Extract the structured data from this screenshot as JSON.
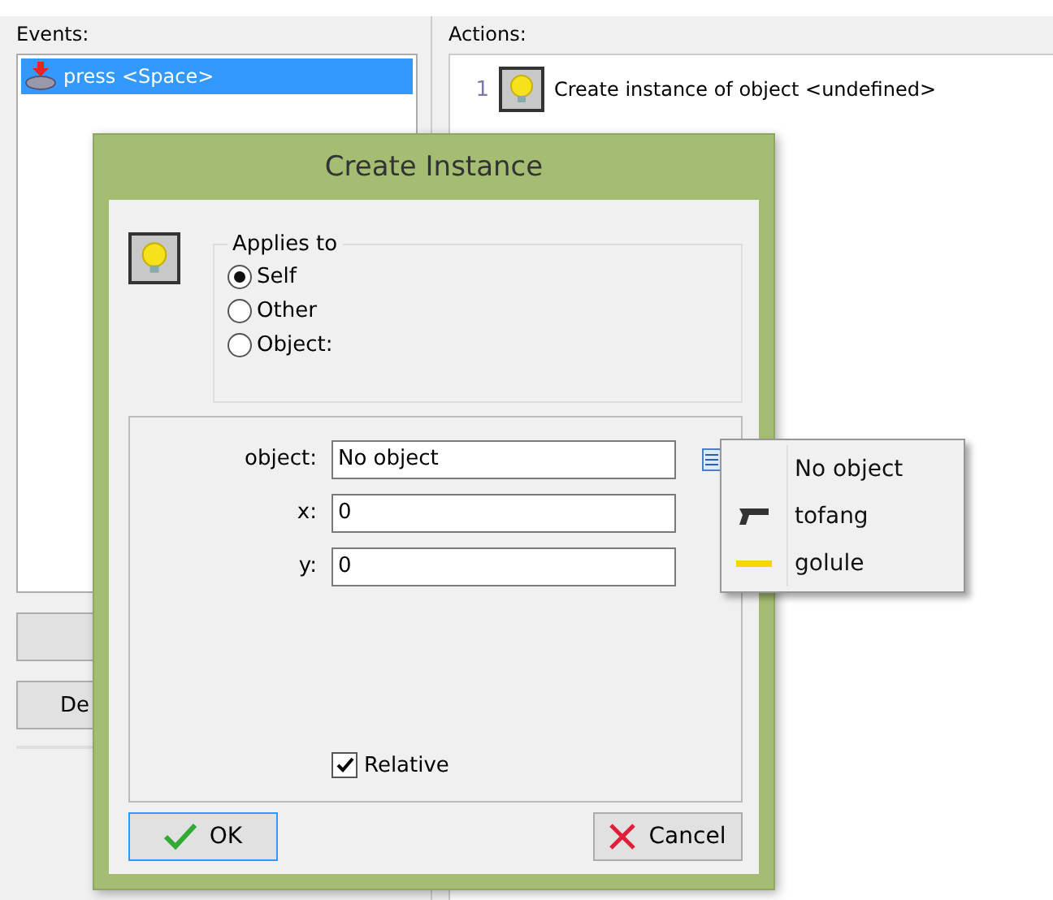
{
  "events": {
    "label": "Events:",
    "items": [
      {
        "label": "press <Space>",
        "selected": true
      }
    ],
    "buttons": [
      {
        "label": "De"
      }
    ]
  },
  "actions": {
    "label": "Actions:",
    "items": [
      {
        "number": "1",
        "text": "Create instance of object <undefined>"
      }
    ]
  },
  "dialog": {
    "title": "Create Instance",
    "applies_to": {
      "label": "Applies to",
      "options": [
        {
          "label": "Self",
          "selected": true
        },
        {
          "label": "Other",
          "selected": false
        },
        {
          "label": "Object:",
          "selected": false
        }
      ]
    },
    "fields": [
      {
        "label": "object:",
        "value": "No object"
      },
      {
        "label": "x:",
        "value": "0"
      },
      {
        "label": "y:",
        "value": "0"
      }
    ],
    "relative": {
      "label": "Relative",
      "checked": true
    },
    "buttons": [
      {
        "label": "OK",
        "kind": "ok",
        "focused": true
      },
      {
        "label": "Cancel",
        "kind": "cancel",
        "focused": false
      }
    ]
  },
  "object_menu": {
    "items": [
      {
        "label": "No object",
        "kind": "blank"
      },
      {
        "label": "tofang",
        "kind": "gun"
      },
      {
        "label": "golule",
        "kind": "bar"
      }
    ]
  }
}
